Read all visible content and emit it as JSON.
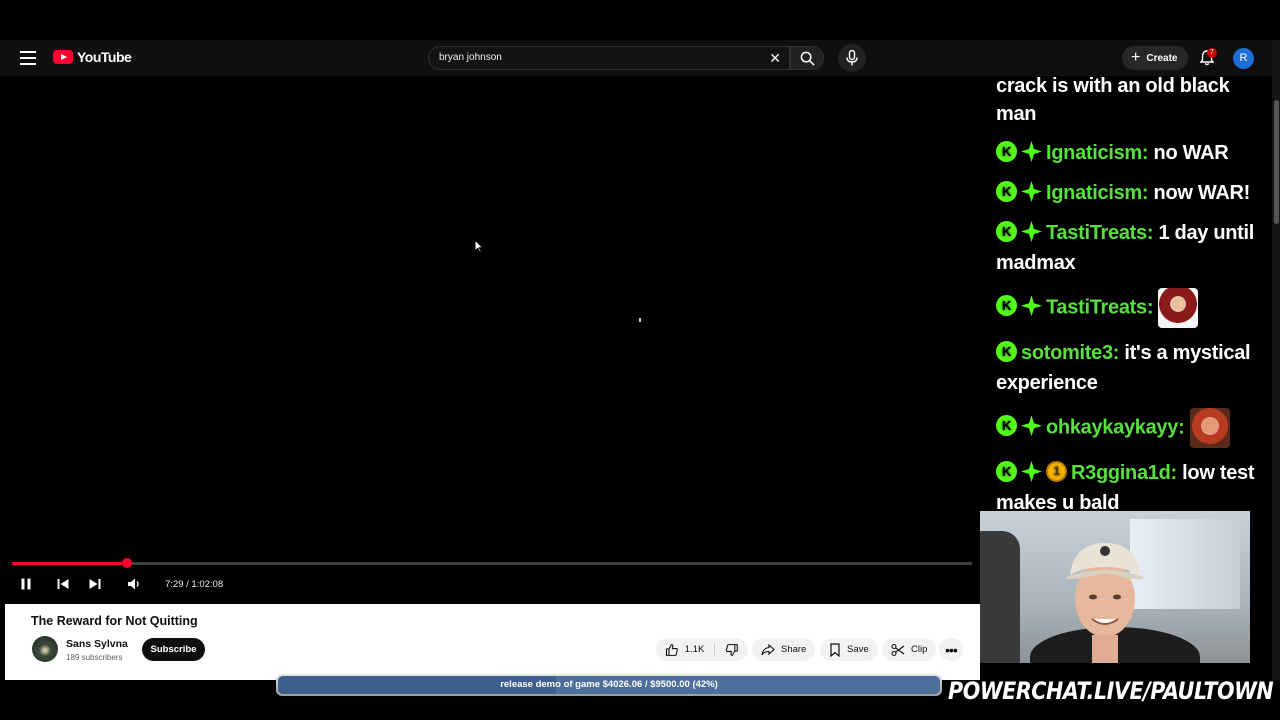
{
  "app": {
    "logo_text": "YouTube"
  },
  "search": {
    "query": "bryan johnson"
  },
  "header": {
    "create_label": "Create",
    "notification_count": "7",
    "avatar_initial": "R"
  },
  "player": {
    "current_time": "7:29",
    "duration": "1:02:08",
    "time_display": "7:29 / 1:02:08",
    "progress_fraction": 0.12
  },
  "video": {
    "title": "The Reward for Not Quitting",
    "channel_name": "Sans Sylvna",
    "subscribers": "189 subscribers",
    "subscribe_label": "Subscribe",
    "like_count": "1.1K",
    "share_label": "Share",
    "save_label": "Save",
    "clip_label": "Clip"
  },
  "chat": {
    "partial_top": "crack is with an old black man",
    "messages": [
      {
        "user": "Ignaticism:",
        "text": "no WAR"
      },
      {
        "user": "Ignaticism:",
        "text": "now WAR!"
      },
      {
        "user": "TastiTreats:",
        "text": "1 day until madmax"
      },
      {
        "user": "TastiTreats:",
        "text": ""
      },
      {
        "user": "sotomite3:",
        "text": "it's a mystical experience"
      },
      {
        "user": "ohkaykaykayy:",
        "text": ""
      },
      {
        "user": "R3ggina1d:",
        "text": "low test makes u bald"
      }
    ]
  },
  "overlay": {
    "goal_text": "release demo of game $4026.06 / $9500.00 (42%)",
    "goal_fraction": 0.42,
    "promo_text": "POWERCHAT.LIVE/PAULTOWN"
  },
  "colors": {
    "brand_red": "#ff0033",
    "chat_user": "#58e03e",
    "kick_green": "#53fc18",
    "goal_bar": "#4d6f9c"
  }
}
